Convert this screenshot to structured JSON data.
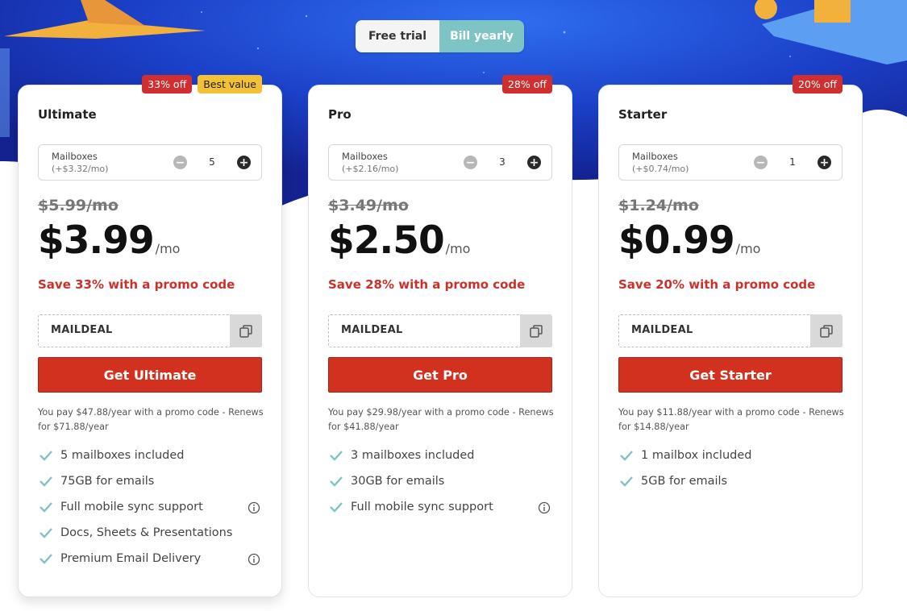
{
  "toggle": {
    "free_trial": "Free trial",
    "bill_yearly": "Bill yearly",
    "selected": "Bill yearly"
  },
  "colors": {
    "accent": "#d2311f",
    "teal": "#7fc4c4",
    "badge_off": "#d12f2f",
    "badge_best": "#f3c136",
    "hero_blue": "#1e4fd6"
  },
  "plans": [
    {
      "name": "Ultimate",
      "badges": [
        "33% off",
        "Best value"
      ],
      "mailboxes_label": "Mailboxes",
      "mailbox_price": "(+$3.32/mo)",
      "mailbox_count": "5",
      "old_price": "$5.99/mo",
      "price": "$3.99",
      "per": "/mo",
      "save": "Save 33% with a promo code",
      "promo_code": "MAILDEAL",
      "cta": "Get Ultimate",
      "note": "You pay $47.88/year with a promo code - Renews for $71.88/year",
      "features": [
        {
          "text": "5 mailboxes included",
          "info": false
        },
        {
          "text": "75GB for emails",
          "info": false
        },
        {
          "text": "Full mobile sync support",
          "info": true
        },
        {
          "text": "Docs, Sheets & Presentations",
          "info": false
        },
        {
          "text": "Premium Email Delivery",
          "info": true
        }
      ]
    },
    {
      "name": "Pro",
      "badges": [
        "28% off"
      ],
      "mailboxes_label": "Mailboxes",
      "mailbox_price": "(+$2.16/mo)",
      "mailbox_count": "3",
      "old_price": "$3.49/mo",
      "price": "$2.50",
      "per": "/mo",
      "save": "Save 28% with a promo code",
      "promo_code": "MAILDEAL",
      "cta": "Get Pro",
      "note": "You pay $29.98/year with a promo code - Renews for $41.88/year",
      "features": [
        {
          "text": "3 mailboxes included",
          "info": false
        },
        {
          "text": "30GB for emails",
          "info": false
        },
        {
          "text": "Full mobile sync support",
          "info": true
        }
      ]
    },
    {
      "name": "Starter",
      "badges": [
        "20% off"
      ],
      "mailboxes_label": "Mailboxes",
      "mailbox_price": "(+$0.74/mo)",
      "mailbox_count": "1",
      "old_price": "$1.24/mo",
      "price": "$0.99",
      "per": "/mo",
      "save": "Save 20% with a promo code",
      "promo_code": "MAILDEAL",
      "cta": "Get Starter",
      "note": "You pay $11.88/year with a promo code - Renews for $14.88/year",
      "features": [
        {
          "text": "1 mailbox included",
          "info": false
        },
        {
          "text": "5GB for emails",
          "info": false
        }
      ]
    }
  ]
}
